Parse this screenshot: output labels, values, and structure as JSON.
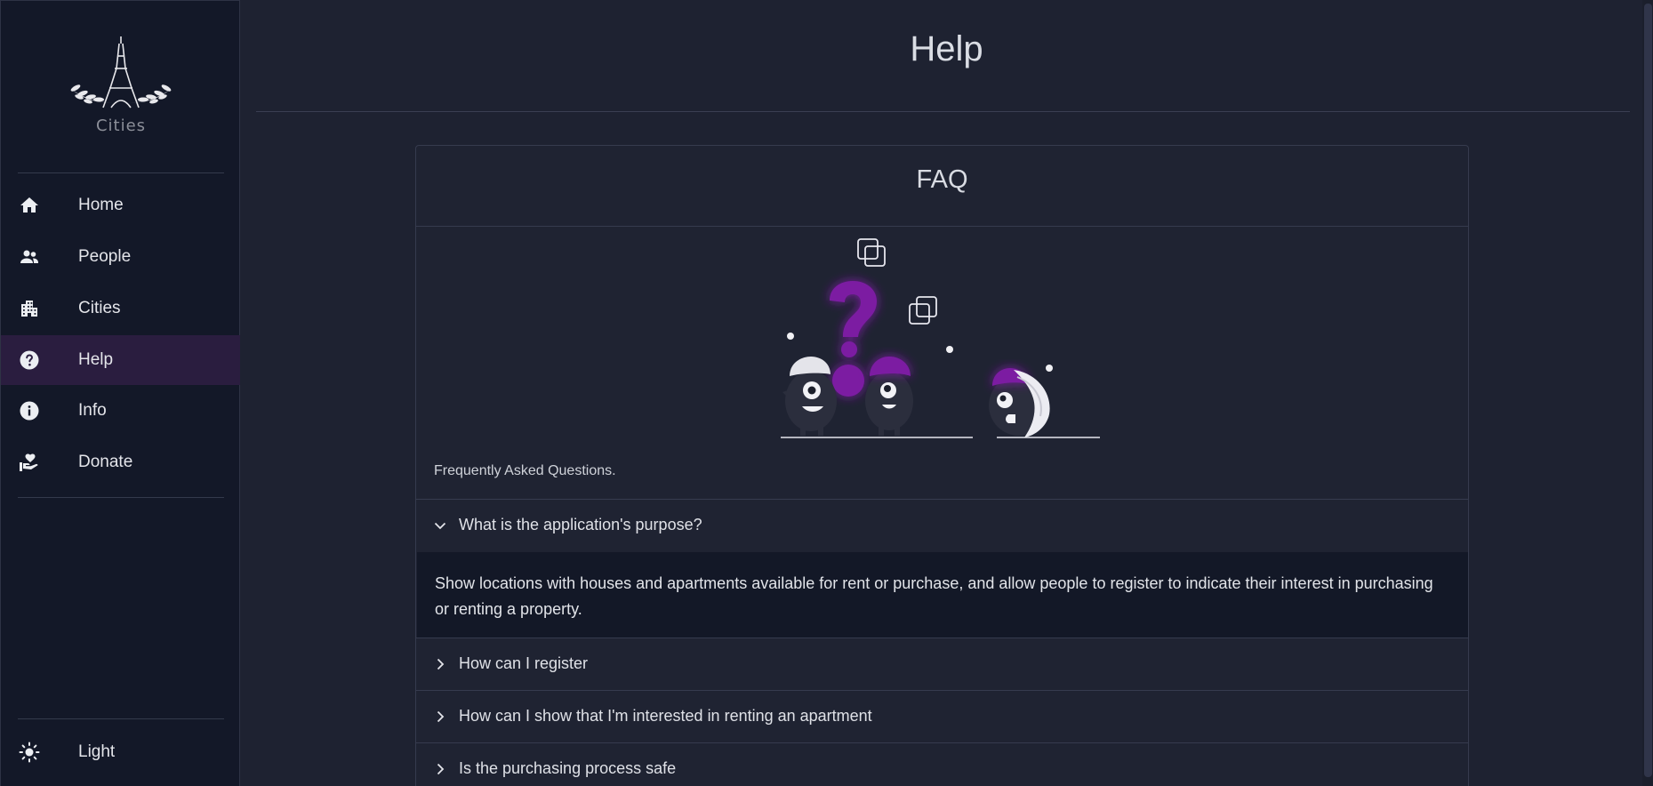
{
  "brand": {
    "logo_text": "Cities"
  },
  "sidebar": {
    "items": [
      {
        "label": "Home",
        "icon": "home-icon"
      },
      {
        "label": "People",
        "icon": "people-icon"
      },
      {
        "label": "Cities",
        "icon": "city-icon"
      },
      {
        "label": "Help",
        "icon": "help-icon",
        "active": true
      },
      {
        "label": "Info",
        "icon": "info-icon"
      },
      {
        "label": "Donate",
        "icon": "donate-icon"
      }
    ],
    "theme_toggle": {
      "label": "Light",
      "icon": "sun-icon"
    }
  },
  "page": {
    "title": "Help"
  },
  "faq": {
    "title": "FAQ",
    "caption": "Frequently Asked Questions.",
    "items": [
      {
        "question": "What is the application's purpose?",
        "expanded": true,
        "answer": "Show locations with houses and apartments available for rent or purchase, and allow people to register to indicate their interest in purchasing or renting a property."
      },
      {
        "question": "How can I register",
        "expanded": false
      },
      {
        "question": "How can I show that I'm interested in renting an apartment",
        "expanded": false
      },
      {
        "question": "Is the purchasing process safe",
        "expanded": false
      }
    ]
  },
  "colors": {
    "sidebar_bg": "#131828",
    "main_bg": "#1e2231",
    "accent_purple": "#7b1fa2",
    "active_bg": "#2a1d3f",
    "answer_bg": "#131827"
  }
}
